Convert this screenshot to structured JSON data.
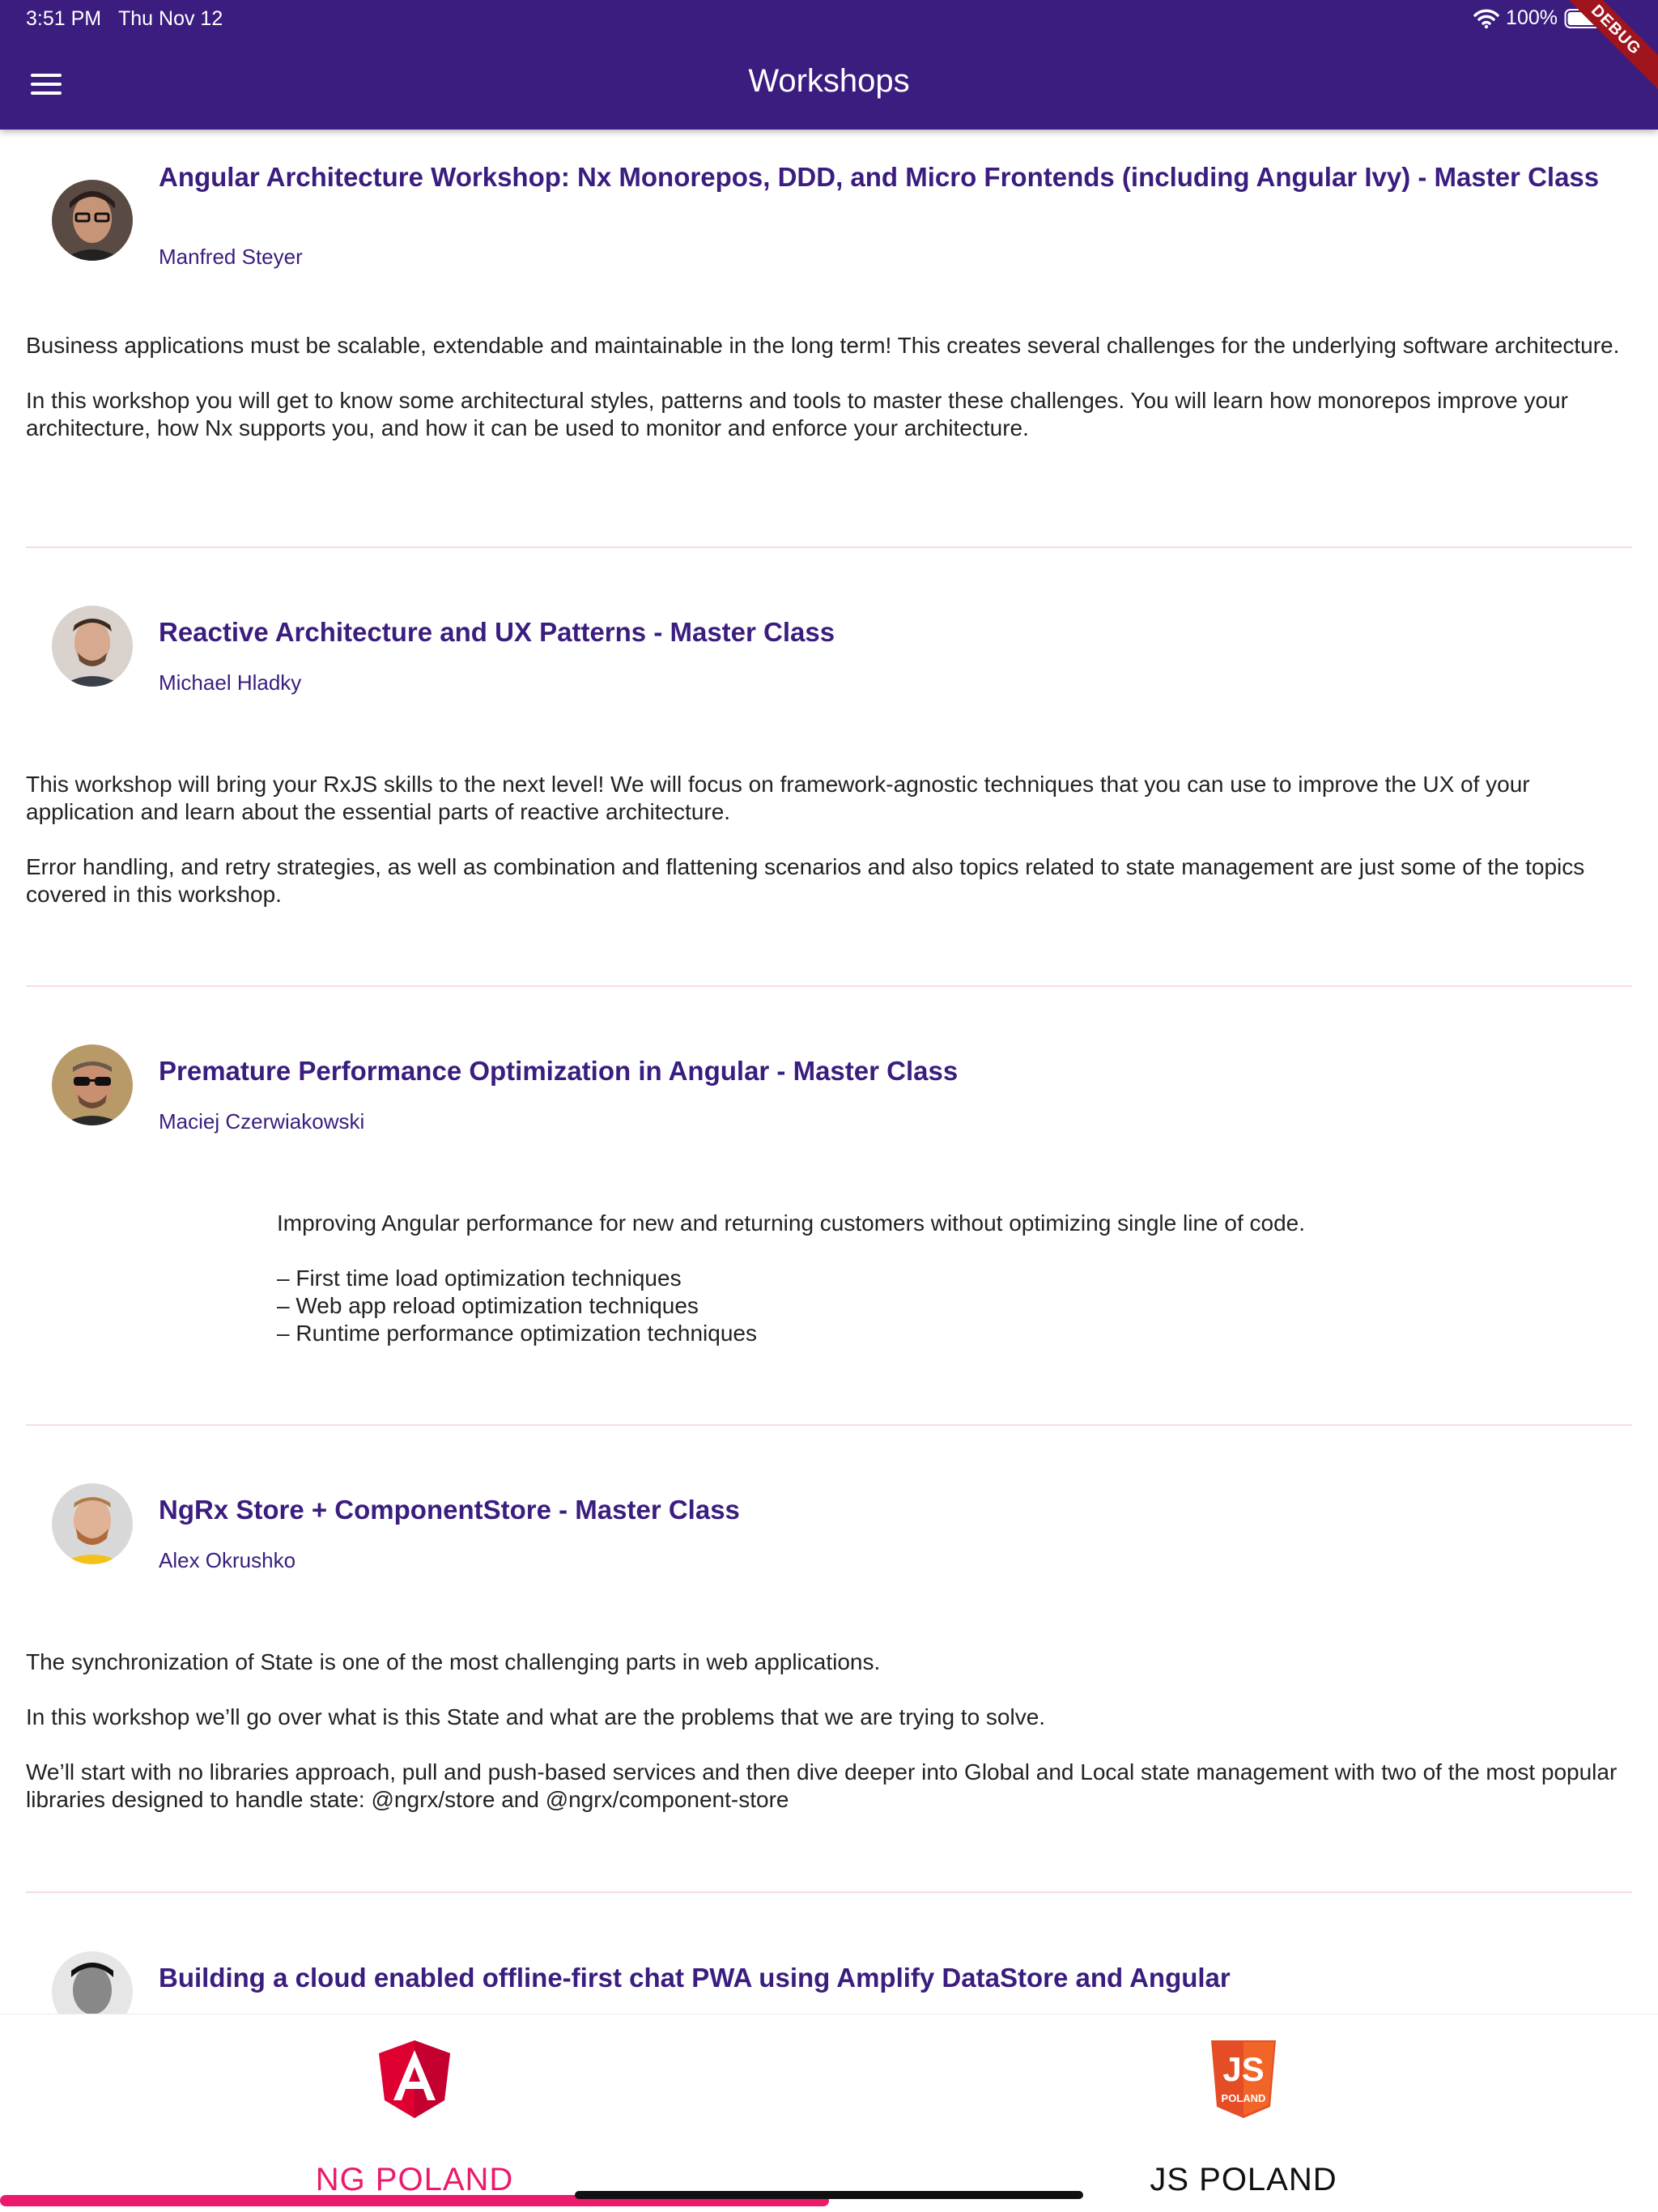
{
  "status_bar": {
    "time": "3:51 PM",
    "date": "Thu Nov 12",
    "battery": "100%"
  },
  "app_bar": {
    "title": "Workshops",
    "debug_banner": "DEBUG"
  },
  "workshops": [
    {
      "title": "Angular Architecture Workshop: Nx Monorepos, DDD, and Micro Frontends (including Angular Ivy) - Master Class",
      "speaker": "Manfred Steyer",
      "description": [
        "Business applications must be scalable, extendable and maintainable in the long term! This creates several challenges for the underlying software architecture.",
        "In this workshop you will get to know some architectural styles, patterns and tools to master these challenges. You will learn how monorepos improve your architecture, how Nx supports you, and how it can be used to monitor and enforce your architecture."
      ]
    },
    {
      "title": "Reactive Architecture and UX Patterns - Master Class",
      "speaker": "Michael Hladky",
      "description": [
        "This workshop will bring your RxJS skills to the next level! We will focus on framework-agnostic techniques that you can use to improve the UX of your application and learn about the essential parts of reactive architecture.",
        "Error handling, and retry strategies, as well as combination and flattening scenarios and also topics related to state management are just some of the topics covered in this workshop."
      ]
    },
    {
      "title": "Premature Performance Optimization in Angular - Master Class",
      "speaker": "Maciej Czerwiakowski",
      "description": [
        "Improving Angular performance for new and returning customers without optimizing single line of code."
      ],
      "bullets": [
        "– First time load optimization techniques",
        "– Web app reload optimization techniques",
        "– Runtime performance optimization techniques"
      ]
    },
    {
      "title": "NgRx Store + ComponentStore - Master Class",
      "speaker": "Alex Okrushko",
      "description": [
        "The synchronization of State is one of the most challenging parts in web applications.",
        "In this workshop we’ll go over what is this State and what are the problems that we are trying to solve.",
        "We’ll start with no libraries approach, pull and push-based services and then dive deeper into Global and Local state management with two of the most popular libraries designed to handle state: @ngrx/store and @ngrx/component-store"
      ]
    },
    {
      "title": "Building a cloud enabled offline-first chat PWA using Amplify DataStore and Angular"
    }
  ],
  "bottom_nav": {
    "items": [
      {
        "label": "NG POLAND",
        "icon": "angular-logo-icon",
        "active": true
      },
      {
        "label": "JS POLAND",
        "icon": "js-logo-icon",
        "active": false
      }
    ],
    "js_logo_caption": "POLAND"
  },
  "colors": {
    "app_bar": "#3a1d7f",
    "title_text": "#3a1d7f",
    "accent": "#ec1a6c",
    "divider": "#f7dbe6"
  }
}
